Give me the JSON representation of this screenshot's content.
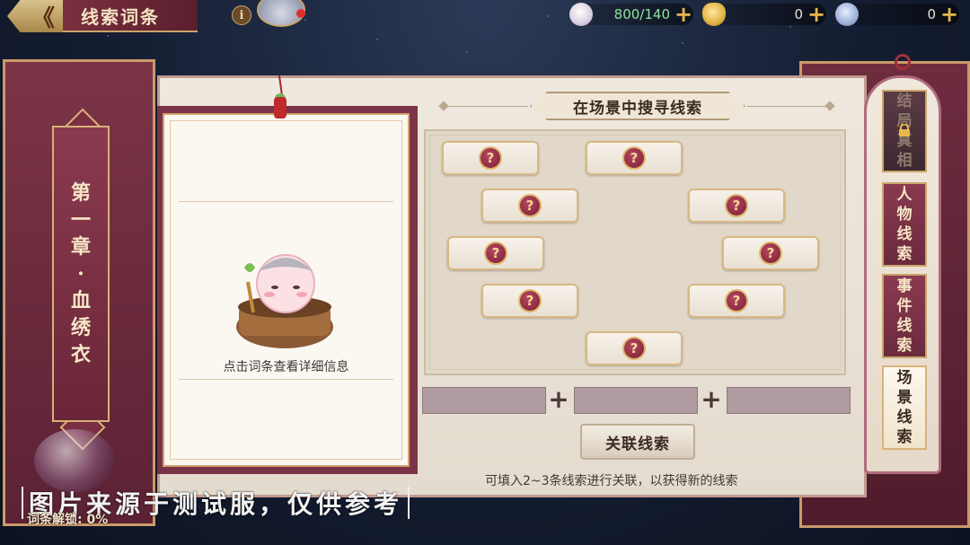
{
  "header": {
    "title": "线索词条",
    "info_icon": "i",
    "currencies": [
      {
        "icon": "bun-icon",
        "value": "800/140",
        "plus": "+"
      },
      {
        "icon": "gold-ingot-icon",
        "value": "0",
        "plus": "+"
      },
      {
        "icon": "coin-icon",
        "value": "0",
        "plus": "+"
      }
    ]
  },
  "chapter": {
    "title_chars": [
      "第",
      "一",
      "章",
      "·",
      "血",
      "绣",
      "衣"
    ]
  },
  "card": {
    "hint": "点击词条查看详细信息"
  },
  "search": {
    "title": "在场景中搜寻线索",
    "clues": [
      {
        "symbol": "?"
      },
      {
        "symbol": "?"
      },
      {
        "symbol": "?"
      },
      {
        "symbol": "?"
      },
      {
        "symbol": "?"
      },
      {
        "symbol": "?"
      },
      {
        "symbol": "?"
      },
      {
        "symbol": "?"
      },
      {
        "symbol": "?"
      }
    ]
  },
  "combine": {
    "plus": "+",
    "button_label": "关联线索",
    "hint": "可填入2~3条线索进行关联，以获得新的线索"
  },
  "tabs": [
    {
      "label_chars": [
        "结",
        "局",
        "真",
        "相"
      ],
      "state": "locked"
    },
    {
      "label_chars": [
        "人",
        "物",
        "线",
        "索"
      ],
      "state": "normal"
    },
    {
      "label_chars": [
        "事",
        "件",
        "线",
        "索"
      ],
      "state": "normal"
    },
    {
      "label_chars": [
        "场",
        "景",
        "线",
        "索"
      ],
      "state": "active"
    }
  ],
  "footer": {
    "watermark": "图片来源于测试服，仅供参考",
    "unlock_label": "词条解锁: 0%"
  },
  "colors": {
    "accent_gold": "#c9a56a",
    "maroon": "#7b3447",
    "clue_red": "#b54660"
  }
}
